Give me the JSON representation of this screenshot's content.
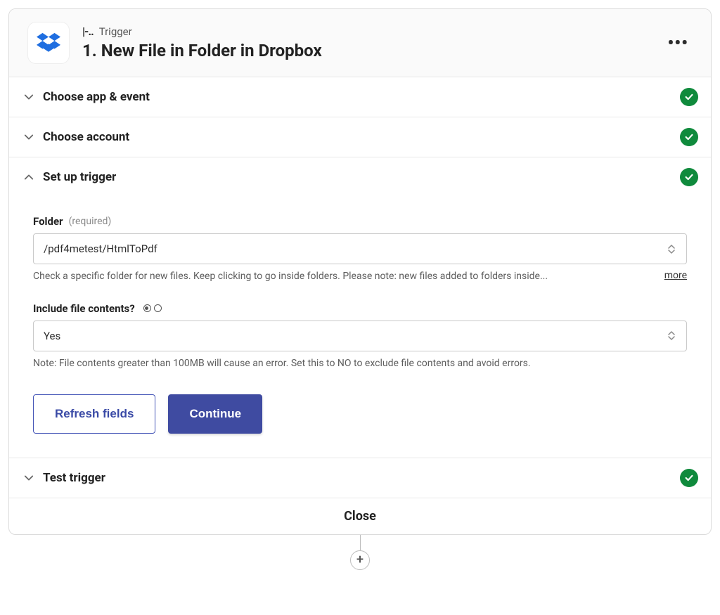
{
  "header": {
    "kicker": "Trigger",
    "title": "1. New File in Folder in Dropbox"
  },
  "sections": {
    "choose_app": {
      "label": "Choose app & event"
    },
    "choose_account": {
      "label": "Choose account"
    },
    "setup_trigger": {
      "label": "Set up trigger"
    },
    "test_trigger": {
      "label": "Test trigger"
    }
  },
  "fields": {
    "folder": {
      "label": "Folder",
      "required": "(required)",
      "value": "/pdf4metest/HtmlToPdf",
      "helper": "Check a specific folder for new files. Keep clicking to go inside folders. Please note: new files added to folders inside...",
      "more": "more"
    },
    "include_contents": {
      "label": "Include file contents?",
      "value": "Yes",
      "helper": "Note: File contents greater than 100MB will cause an error. Set this to NO to exclude file contents and avoid errors."
    }
  },
  "buttons": {
    "refresh": "Refresh fields",
    "continue": "Continue"
  },
  "footer": {
    "close": "Close"
  }
}
